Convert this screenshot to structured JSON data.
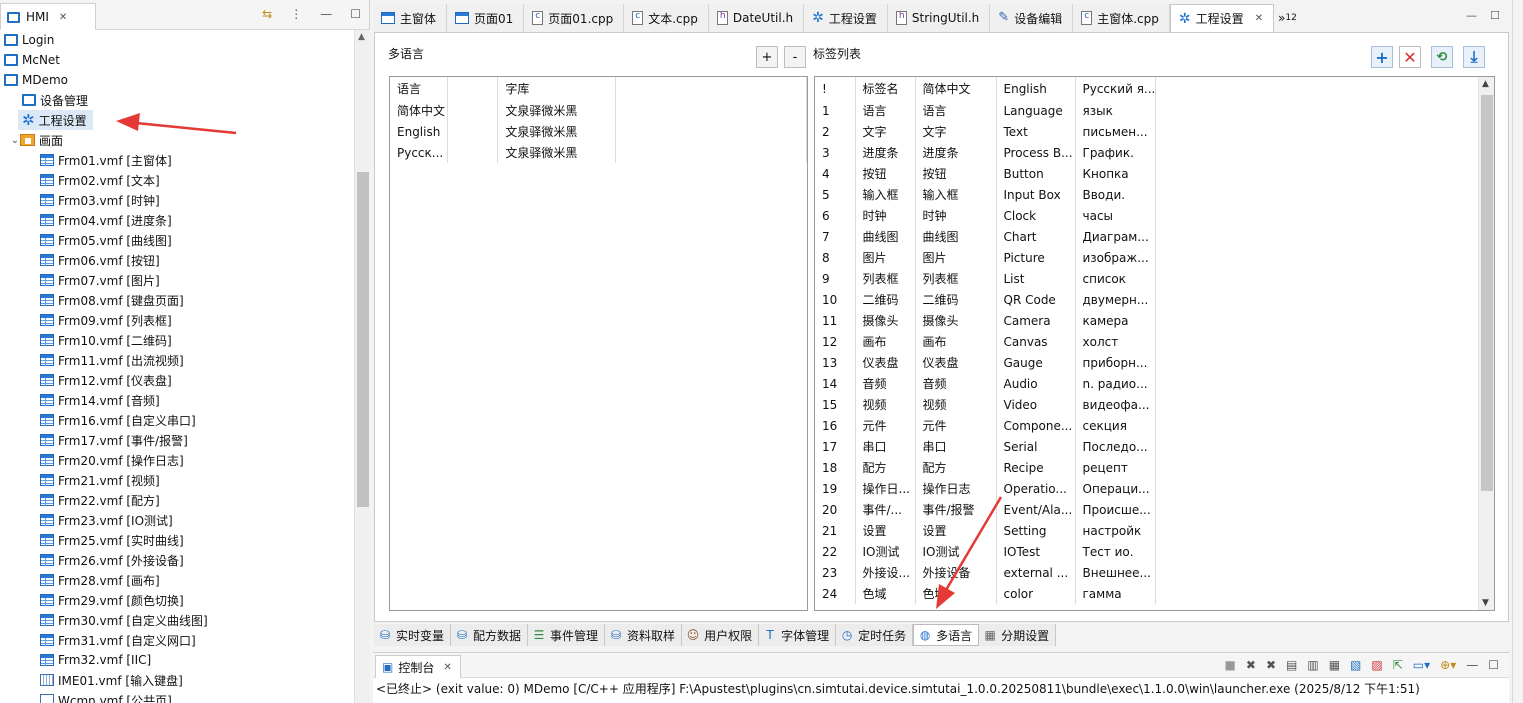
{
  "left_panel": {
    "tab_label": "HMI",
    "tree": [
      {
        "label": "Login",
        "indent": 0,
        "icon": "screen"
      },
      {
        "label": "McNet",
        "indent": 0,
        "icon": "screen"
      },
      {
        "label": "MDemo",
        "indent": 0,
        "icon": "screen"
      },
      {
        "label": "设备管理",
        "indent": 1,
        "icon": "screen"
      },
      {
        "label": "工程设置",
        "indent": 1,
        "icon": "gear",
        "selected": true
      },
      {
        "label": "画面",
        "indent": 1,
        "icon": "folder",
        "expanded": true
      },
      {
        "label": "Frm01.vmf [主窗体]",
        "indent": 2,
        "icon": "frm-main"
      },
      {
        "label": "Frm02.vmf [文本]",
        "indent": 2,
        "icon": "frm"
      },
      {
        "label": "Frm03.vmf [时钟]",
        "indent": 2,
        "icon": "frm"
      },
      {
        "label": "Frm04.vmf [进度条]",
        "indent": 2,
        "icon": "frm"
      },
      {
        "label": "Frm05.vmf [曲线图]",
        "indent": 2,
        "icon": "frm"
      },
      {
        "label": "Frm06.vmf [按钮]",
        "indent": 2,
        "icon": "frm"
      },
      {
        "label": "Frm07.vmf [图片]",
        "indent": 2,
        "icon": "frm"
      },
      {
        "label": "Frm08.vmf [键盘页面]",
        "indent": 2,
        "icon": "frm"
      },
      {
        "label": "Frm09.vmf [列表框]",
        "indent": 2,
        "icon": "frm"
      },
      {
        "label": "Frm10.vmf [二维码]",
        "indent": 2,
        "icon": "frm"
      },
      {
        "label": "Frm11.vmf [出流视频]",
        "indent": 2,
        "icon": "frm"
      },
      {
        "label": "Frm12.vmf [仪表盘]",
        "indent": 2,
        "icon": "frm"
      },
      {
        "label": "Frm14.vmf [音频]",
        "indent": 2,
        "icon": "frm"
      },
      {
        "label": "Frm16.vmf [自定义串口]",
        "indent": 2,
        "icon": "frm"
      },
      {
        "label": "Frm17.vmf [事件/报警]",
        "indent": 2,
        "icon": "frm"
      },
      {
        "label": "Frm20.vmf [操作日志]",
        "indent": 2,
        "icon": "frm"
      },
      {
        "label": "Frm21.vmf [视频]",
        "indent": 2,
        "icon": "frm"
      },
      {
        "label": "Frm22.vmf [配方]",
        "indent": 2,
        "icon": "frm"
      },
      {
        "label": "Frm23.vmf [IO测试]",
        "indent": 2,
        "icon": "frm"
      },
      {
        "label": "Frm25.vmf [实时曲线]",
        "indent": 2,
        "icon": "frm"
      },
      {
        "label": "Frm26.vmf [外接设备]",
        "indent": 2,
        "icon": "frm"
      },
      {
        "label": "Frm28.vmf [画布]",
        "indent": 2,
        "icon": "frm"
      },
      {
        "label": "Frm29.vmf [颜色切换]",
        "indent": 2,
        "icon": "frm"
      },
      {
        "label": "Frm30.vmf [自定义曲线图]",
        "indent": 2,
        "icon": "frm"
      },
      {
        "label": "Frm31.vmf [自定义网口]",
        "indent": 2,
        "icon": "frm"
      },
      {
        "label": "Frm32.vmf [IIC]",
        "indent": 2,
        "icon": "frm"
      },
      {
        "label": "IME01.vmf [输入键盘]",
        "indent": 2,
        "icon": "kbd"
      },
      {
        "label": "Wcmn.vmf [公共页]",
        "indent": 2,
        "icon": "blank"
      }
    ]
  },
  "editor_tabs": [
    {
      "label": "主窗体",
      "icon": "frm"
    },
    {
      "label": "页面01",
      "icon": "frm"
    },
    {
      "label": "页面01.cpp",
      "icon": "cpp"
    },
    {
      "label": "文本.cpp",
      "icon": "cpp"
    },
    {
      "label": "DateUtil.h",
      "icon": "h"
    },
    {
      "label": "工程设置",
      "icon": "gear"
    },
    {
      "label": "StringUtil.h",
      "icon": "h"
    },
    {
      "label": "设备编辑",
      "icon": "device"
    },
    {
      "label": "主窗体.cpp",
      "icon": "cpp"
    },
    {
      "label": "工程设置",
      "icon": "gear",
      "active": true
    }
  ],
  "tab_overflow": {
    "glyph": "»",
    "count": "12"
  },
  "multilang": {
    "title": "多语言",
    "add_label": "+",
    "remove_label": "-",
    "headers": [
      "语言",
      "",
      "字库"
    ],
    "rows": [
      [
        "简体中文",
        "",
        "文泉驿微米黑"
      ],
      [
        "English",
        "",
        "文泉驿微米黑"
      ],
      [
        "Рyсск...",
        "",
        "文泉驿微米黑"
      ]
    ]
  },
  "label_list": {
    "title": "标签列表",
    "headers": [
      "!",
      "标签名",
      "简体中文",
      "English",
      "Русский я..."
    ],
    "rows": [
      [
        "1",
        "语言",
        "语言",
        "Language",
        "язык"
      ],
      [
        "2",
        "文字",
        "文字",
        "Text",
        "письмен..."
      ],
      [
        "3",
        "进度条",
        "进度条",
        "Process B...",
        "График."
      ],
      [
        "4",
        "按钮",
        "按钮",
        "Button",
        "Кнопка"
      ],
      [
        "5",
        "输入框",
        "输入框",
        "Input Box",
        "Вводи."
      ],
      [
        "6",
        "时钟",
        "时钟",
        "Clock",
        "часы"
      ],
      [
        "7",
        "曲线图",
        "曲线图",
        "Chart",
        "Диаграм..."
      ],
      [
        "8",
        "图片",
        "图片",
        "Picture",
        "изображ..."
      ],
      [
        "9",
        "列表框",
        "列表框",
        "List",
        "список"
      ],
      [
        "10",
        "二维码",
        "二维码",
        "QR Code",
        "двумерн..."
      ],
      [
        "11",
        "摄像头",
        "摄像头",
        "Camera",
        "камера"
      ],
      [
        "12",
        "画布",
        "画布",
        "Canvas",
        "холст"
      ],
      [
        "13",
        "仪表盘",
        "仪表盘",
        "Gauge",
        "приборн..."
      ],
      [
        "14",
        "音频",
        "音频",
        "Audio",
        "n. радио..."
      ],
      [
        "15",
        "视频",
        "视频",
        "Video",
        "видеофа..."
      ],
      [
        "16",
        "元件",
        "元件",
        "Compone...",
        "секция"
      ],
      [
        "17",
        "串口",
        "串口",
        "Serial",
        "Последо..."
      ],
      [
        "18",
        "配方",
        "配方",
        "Recipe",
        "рецепт"
      ],
      [
        "19",
        "操作日...",
        "操作日志",
        "Operatio...",
        "Операци..."
      ],
      [
        "20",
        "事件/...",
        "事件/报警",
        "Event/Ala...",
        "Происше..."
      ],
      [
        "21",
        "设置",
        "设置",
        "Setting",
        "настройк"
      ],
      [
        "22",
        "IO测试",
        "IO测试",
        "IOTest",
        "Тест ио."
      ],
      [
        "23",
        "外接设...",
        "外接设备",
        "external ...",
        "Внешнее..."
      ],
      [
        "24",
        "色域",
        "色域",
        "color",
        "гамма"
      ]
    ]
  },
  "bottom_tabs": [
    {
      "label": "实时变量",
      "icon": "db"
    },
    {
      "label": "配方数据",
      "icon": "db"
    },
    {
      "label": "事件管理",
      "icon": "list"
    },
    {
      "label": "资料取样",
      "icon": "db"
    },
    {
      "label": "用户权限",
      "icon": "user"
    },
    {
      "label": "字体管理",
      "icon": "font"
    },
    {
      "label": "定时任务",
      "icon": "clock"
    },
    {
      "label": "多语言",
      "icon": "globe",
      "active": true
    },
    {
      "label": "分期设置",
      "icon": "grid"
    }
  ],
  "console": {
    "tab_label": "控制台",
    "line": "<已终止> (exit value: 0) MDemo [C/C++ 应用程序] F:\\Apustest\\plugins\\cn.simtutai.device.simtutai_1.0.0.20250811\\bundle\\exec\\1.1.0.0\\win\\launcher.exe (2025/8/12 下午1:51)"
  },
  "colors": {
    "accent": "#1f6fc5",
    "arrow": "#e53935",
    "selection": "#dde8f7"
  }
}
